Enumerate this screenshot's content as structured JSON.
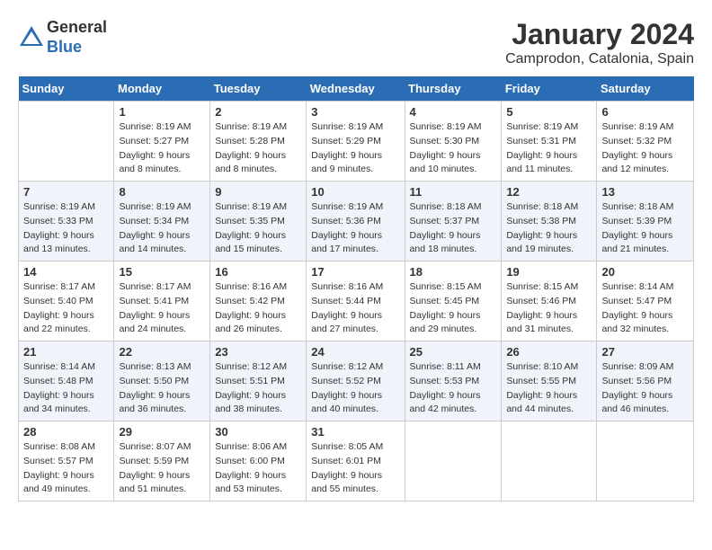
{
  "header": {
    "logo_general": "General",
    "logo_blue": "Blue",
    "month_title": "January 2024",
    "location": "Camprodon, Catalonia, Spain"
  },
  "weekdays": [
    "Sunday",
    "Monday",
    "Tuesday",
    "Wednesday",
    "Thursday",
    "Friday",
    "Saturday"
  ],
  "weeks": [
    [
      {
        "num": "",
        "sunrise": "",
        "sunset": "",
        "daylight": ""
      },
      {
        "num": "1",
        "sunrise": "Sunrise: 8:19 AM",
        "sunset": "Sunset: 5:27 PM",
        "daylight": "Daylight: 9 hours and 8 minutes."
      },
      {
        "num": "2",
        "sunrise": "Sunrise: 8:19 AM",
        "sunset": "Sunset: 5:28 PM",
        "daylight": "Daylight: 9 hours and 8 minutes."
      },
      {
        "num": "3",
        "sunrise": "Sunrise: 8:19 AM",
        "sunset": "Sunset: 5:29 PM",
        "daylight": "Daylight: 9 hours and 9 minutes."
      },
      {
        "num": "4",
        "sunrise": "Sunrise: 8:19 AM",
        "sunset": "Sunset: 5:30 PM",
        "daylight": "Daylight: 9 hours and 10 minutes."
      },
      {
        "num": "5",
        "sunrise": "Sunrise: 8:19 AM",
        "sunset": "Sunset: 5:31 PM",
        "daylight": "Daylight: 9 hours and 11 minutes."
      },
      {
        "num": "6",
        "sunrise": "Sunrise: 8:19 AM",
        "sunset": "Sunset: 5:32 PM",
        "daylight": "Daylight: 9 hours and 12 minutes."
      }
    ],
    [
      {
        "num": "7",
        "sunrise": "Sunrise: 8:19 AM",
        "sunset": "Sunset: 5:33 PM",
        "daylight": "Daylight: 9 hours and 13 minutes."
      },
      {
        "num": "8",
        "sunrise": "Sunrise: 8:19 AM",
        "sunset": "Sunset: 5:34 PM",
        "daylight": "Daylight: 9 hours and 14 minutes."
      },
      {
        "num": "9",
        "sunrise": "Sunrise: 8:19 AM",
        "sunset": "Sunset: 5:35 PM",
        "daylight": "Daylight: 9 hours and 15 minutes."
      },
      {
        "num": "10",
        "sunrise": "Sunrise: 8:19 AM",
        "sunset": "Sunset: 5:36 PM",
        "daylight": "Daylight: 9 hours and 17 minutes."
      },
      {
        "num": "11",
        "sunrise": "Sunrise: 8:18 AM",
        "sunset": "Sunset: 5:37 PM",
        "daylight": "Daylight: 9 hours and 18 minutes."
      },
      {
        "num": "12",
        "sunrise": "Sunrise: 8:18 AM",
        "sunset": "Sunset: 5:38 PM",
        "daylight": "Daylight: 9 hours and 19 minutes."
      },
      {
        "num": "13",
        "sunrise": "Sunrise: 8:18 AM",
        "sunset": "Sunset: 5:39 PM",
        "daylight": "Daylight: 9 hours and 21 minutes."
      }
    ],
    [
      {
        "num": "14",
        "sunrise": "Sunrise: 8:17 AM",
        "sunset": "Sunset: 5:40 PM",
        "daylight": "Daylight: 9 hours and 22 minutes."
      },
      {
        "num": "15",
        "sunrise": "Sunrise: 8:17 AM",
        "sunset": "Sunset: 5:41 PM",
        "daylight": "Daylight: 9 hours and 24 minutes."
      },
      {
        "num": "16",
        "sunrise": "Sunrise: 8:16 AM",
        "sunset": "Sunset: 5:42 PM",
        "daylight": "Daylight: 9 hours and 26 minutes."
      },
      {
        "num": "17",
        "sunrise": "Sunrise: 8:16 AM",
        "sunset": "Sunset: 5:44 PM",
        "daylight": "Daylight: 9 hours and 27 minutes."
      },
      {
        "num": "18",
        "sunrise": "Sunrise: 8:15 AM",
        "sunset": "Sunset: 5:45 PM",
        "daylight": "Daylight: 9 hours and 29 minutes."
      },
      {
        "num": "19",
        "sunrise": "Sunrise: 8:15 AM",
        "sunset": "Sunset: 5:46 PM",
        "daylight": "Daylight: 9 hours and 31 minutes."
      },
      {
        "num": "20",
        "sunrise": "Sunrise: 8:14 AM",
        "sunset": "Sunset: 5:47 PM",
        "daylight": "Daylight: 9 hours and 32 minutes."
      }
    ],
    [
      {
        "num": "21",
        "sunrise": "Sunrise: 8:14 AM",
        "sunset": "Sunset: 5:48 PM",
        "daylight": "Daylight: 9 hours and 34 minutes."
      },
      {
        "num": "22",
        "sunrise": "Sunrise: 8:13 AM",
        "sunset": "Sunset: 5:50 PM",
        "daylight": "Daylight: 9 hours and 36 minutes."
      },
      {
        "num": "23",
        "sunrise": "Sunrise: 8:12 AM",
        "sunset": "Sunset: 5:51 PM",
        "daylight": "Daylight: 9 hours and 38 minutes."
      },
      {
        "num": "24",
        "sunrise": "Sunrise: 8:12 AM",
        "sunset": "Sunset: 5:52 PM",
        "daylight": "Daylight: 9 hours and 40 minutes."
      },
      {
        "num": "25",
        "sunrise": "Sunrise: 8:11 AM",
        "sunset": "Sunset: 5:53 PM",
        "daylight": "Daylight: 9 hours and 42 minutes."
      },
      {
        "num": "26",
        "sunrise": "Sunrise: 8:10 AM",
        "sunset": "Sunset: 5:55 PM",
        "daylight": "Daylight: 9 hours and 44 minutes."
      },
      {
        "num": "27",
        "sunrise": "Sunrise: 8:09 AM",
        "sunset": "Sunset: 5:56 PM",
        "daylight": "Daylight: 9 hours and 46 minutes."
      }
    ],
    [
      {
        "num": "28",
        "sunrise": "Sunrise: 8:08 AM",
        "sunset": "Sunset: 5:57 PM",
        "daylight": "Daylight: 9 hours and 49 minutes."
      },
      {
        "num": "29",
        "sunrise": "Sunrise: 8:07 AM",
        "sunset": "Sunset: 5:59 PM",
        "daylight": "Daylight: 9 hours and 51 minutes."
      },
      {
        "num": "30",
        "sunrise": "Sunrise: 8:06 AM",
        "sunset": "Sunset: 6:00 PM",
        "daylight": "Daylight: 9 hours and 53 minutes."
      },
      {
        "num": "31",
        "sunrise": "Sunrise: 8:05 AM",
        "sunset": "Sunset: 6:01 PM",
        "daylight": "Daylight: 9 hours and 55 minutes."
      },
      {
        "num": "",
        "sunrise": "",
        "sunset": "",
        "daylight": ""
      },
      {
        "num": "",
        "sunrise": "",
        "sunset": "",
        "daylight": ""
      },
      {
        "num": "",
        "sunrise": "",
        "sunset": "",
        "daylight": ""
      }
    ]
  ]
}
